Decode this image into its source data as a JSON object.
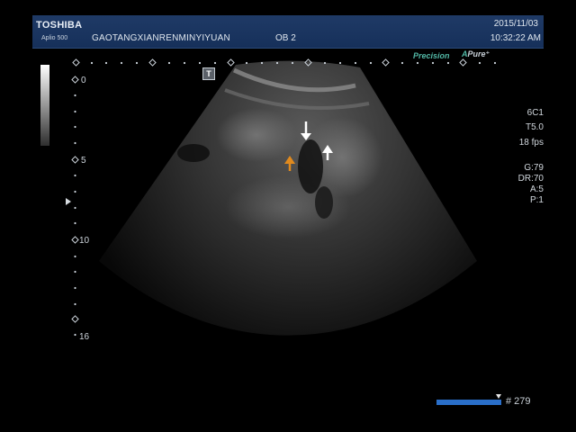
{
  "header": {
    "brand": "TOSHIBA",
    "model": "Aplio 500",
    "hospital": "GAOTANGXIANRENMINYIYUAN",
    "preset": "OB 2",
    "date": "2015/11/03",
    "time": "10:32:22 AM"
  },
  "tags": {
    "precision": "Precision",
    "apure_a": "A",
    "apure_rest": "Pure⁺"
  },
  "image_markers": {
    "t_label": "T"
  },
  "depth_scale": {
    "labels": [
      "0",
      "5",
      "10",
      "16"
    ]
  },
  "params": {
    "probe": "6C1",
    "thi": "T5.0",
    "fps": "18 fps",
    "gain": "G:79",
    "dynamic_range": "DR:70",
    "a": "A:5",
    "p": "P:1"
  },
  "cine": {
    "frame": "# 279"
  },
  "colors": {
    "header_bg": "#1f3a66",
    "accent_teal": "#52b8a6",
    "cine_bar": "#2a6fc9",
    "arrow_white": "#ffffff",
    "arrow_orange": "#e08a1e"
  }
}
